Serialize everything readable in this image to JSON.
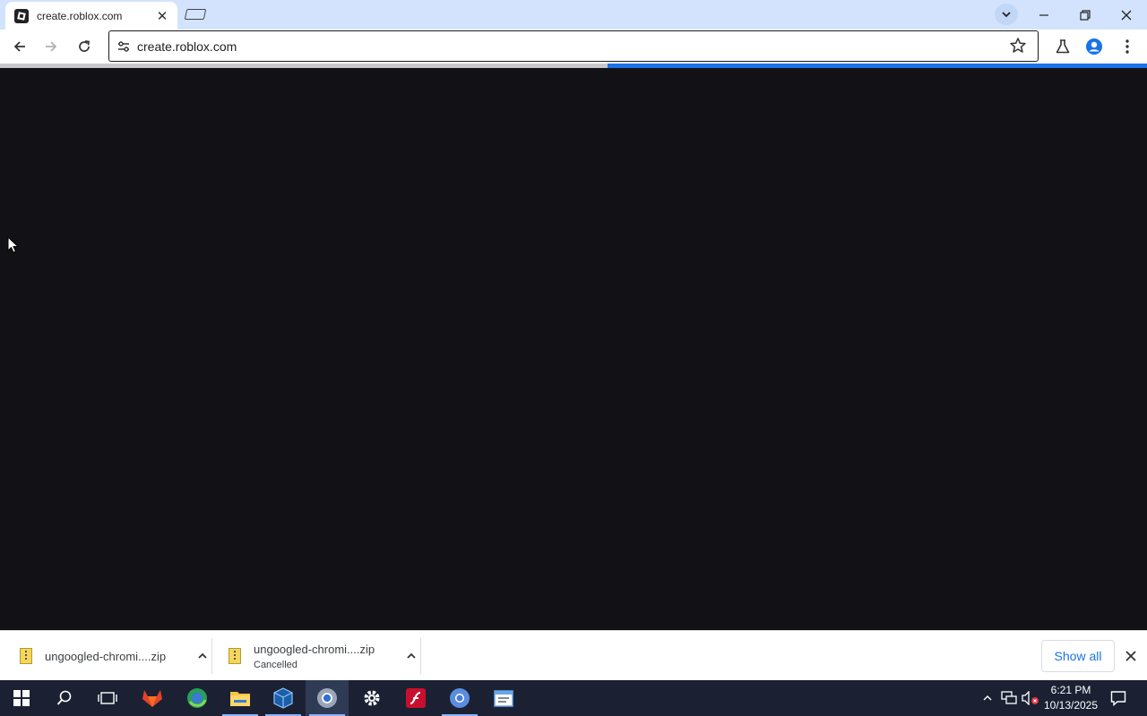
{
  "browser": {
    "tab": {
      "title": "create.roblox.com"
    },
    "omnibox": {
      "url": "create.roblox.com"
    },
    "progress": 0.47
  },
  "downloads": {
    "items": [
      {
        "name": "ungoogled-chromi....zip",
        "status": ""
      },
      {
        "name": "ungoogled-chromi....zip",
        "status": "Cancelled"
      }
    ],
    "show_all_label": "Show all"
  },
  "taskbar": {
    "apps": [
      "start-icon",
      "search-icon",
      "task-view-icon",
      "gitlab-icon",
      "edge-icon",
      "file-explorer-icon",
      "virtualbox-icon",
      "chrome-icon",
      "settings-icon",
      "flash-icon",
      "chromium-icon",
      "notepad-icon"
    ],
    "clock": {
      "time": "6:21 PM",
      "date": "10/13/2025"
    }
  },
  "colors": {
    "tabstrip": "#d3e3fd",
    "content_bg": "#121216",
    "progress": "#1a73e8",
    "taskbar": "#1b2133",
    "link": "#1a73e8"
  }
}
